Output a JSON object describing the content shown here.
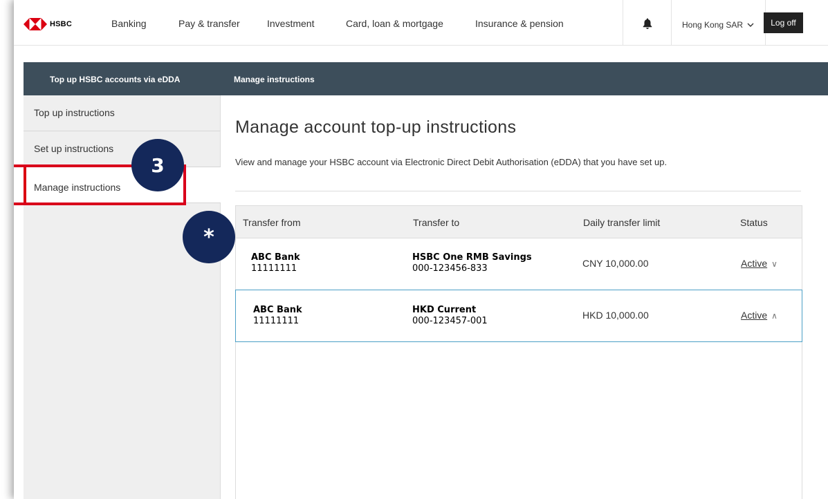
{
  "nav": {
    "logo_text": "HSBC",
    "items": [
      "Banking",
      "Pay & transfer",
      "Investment",
      "Card, loan & mortgage",
      "Insurance & pension"
    ],
    "region": "Hong Kong SAR",
    "logoff": "Log off",
    "icons": [
      "hsbc-hexagon-logo",
      "bell-icon",
      "chevron-down-icon"
    ]
  },
  "subbar": {
    "section": "Top up HSBC accounts via eDDA",
    "current": "Manage instructions"
  },
  "sidebar": {
    "items": [
      {
        "label": "Top up instructions"
      },
      {
        "label": "Set up instructions"
      },
      {
        "label": "Manage instructions",
        "active": true
      }
    ]
  },
  "annotations": {
    "step": "3",
    "note": "*"
  },
  "main": {
    "title": "Manage account top-up instructions",
    "description": "View and manage your HSBC account via Electronic Direct Debit Authorisation (eDDA) that you have set up."
  },
  "table": {
    "headers": [
      "Transfer from",
      "Transfer to",
      "Daily transfer limit",
      "Status"
    ],
    "rows": [
      {
        "from_bank": "ABC Bank",
        "from_account": "11111111",
        "to_name": "HSBC One RMB Savings",
        "to_account": "000-123456-833",
        "limit": "CNY 10,000.00",
        "status": "Active",
        "chevron": "chevron-down-icon",
        "chev_char": "∨"
      },
      {
        "from_bank": "ABC Bank",
        "from_account": "11111111",
        "to_name": "HKD Current",
        "to_account": "000-123457-001",
        "limit": "HKD 10,000.00",
        "status": "Active",
        "chevron": "chevron-up-icon",
        "chev_char": "∧"
      }
    ]
  },
  "colors": {
    "brand_red": "#db0011",
    "subbar_bg": "#3d4e5b",
    "badge_navy": "#14285a",
    "highlight_red": "#d9001b",
    "selected_row_border": "#4a9fc6"
  }
}
